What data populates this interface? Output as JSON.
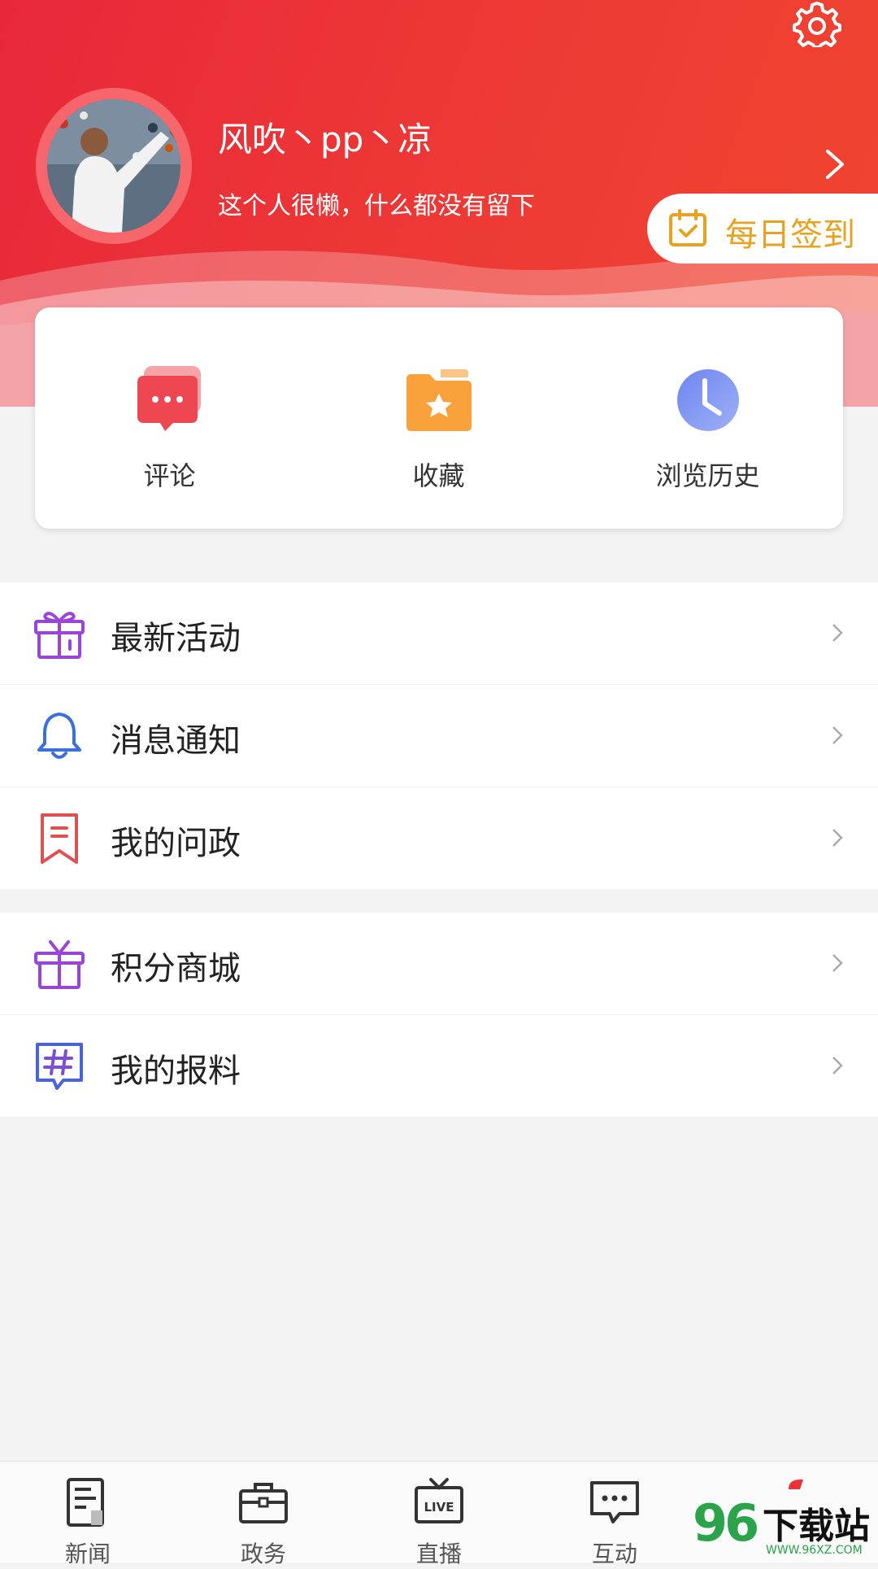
{
  "profile": {
    "username": "风吹丶pp丶凉",
    "bio": "这个人很懒，什么都没有留下"
  },
  "signin": {
    "label": "每日签到"
  },
  "quick_actions": [
    {
      "label": "评论",
      "icon": "comment-icon"
    },
    {
      "label": "收藏",
      "icon": "favorite-folder-icon"
    },
    {
      "label": "浏览历史",
      "icon": "history-clock-icon"
    }
  ],
  "menu_group1": [
    {
      "label": "最新活动",
      "icon": "gift-box-icon"
    },
    {
      "label": "消息通知",
      "icon": "bell-icon"
    },
    {
      "label": "我的问政",
      "icon": "bookmark-icon"
    }
  ],
  "menu_group2": [
    {
      "label": "积分商城",
      "icon": "gift-icon"
    },
    {
      "label": "我的报料",
      "icon": "hashtag-chat-icon"
    }
  ],
  "tabbar": [
    {
      "label": "新闻",
      "icon": "news-icon"
    },
    {
      "label": "政务",
      "icon": "briefcase-icon"
    },
    {
      "label": "直播",
      "icon": "live-tv-icon"
    },
    {
      "label": "互动",
      "icon": "chat-icon"
    }
  ],
  "watermark": {
    "number": "96",
    "text": "下载站",
    "url": "WWW.96XZ.COM"
  },
  "colors": {
    "header_red": "#ec3236",
    "signin_gold": "#e8a21f",
    "purple": "#9b45d8",
    "blue": "#3b6fe0",
    "red": "#e05050"
  }
}
